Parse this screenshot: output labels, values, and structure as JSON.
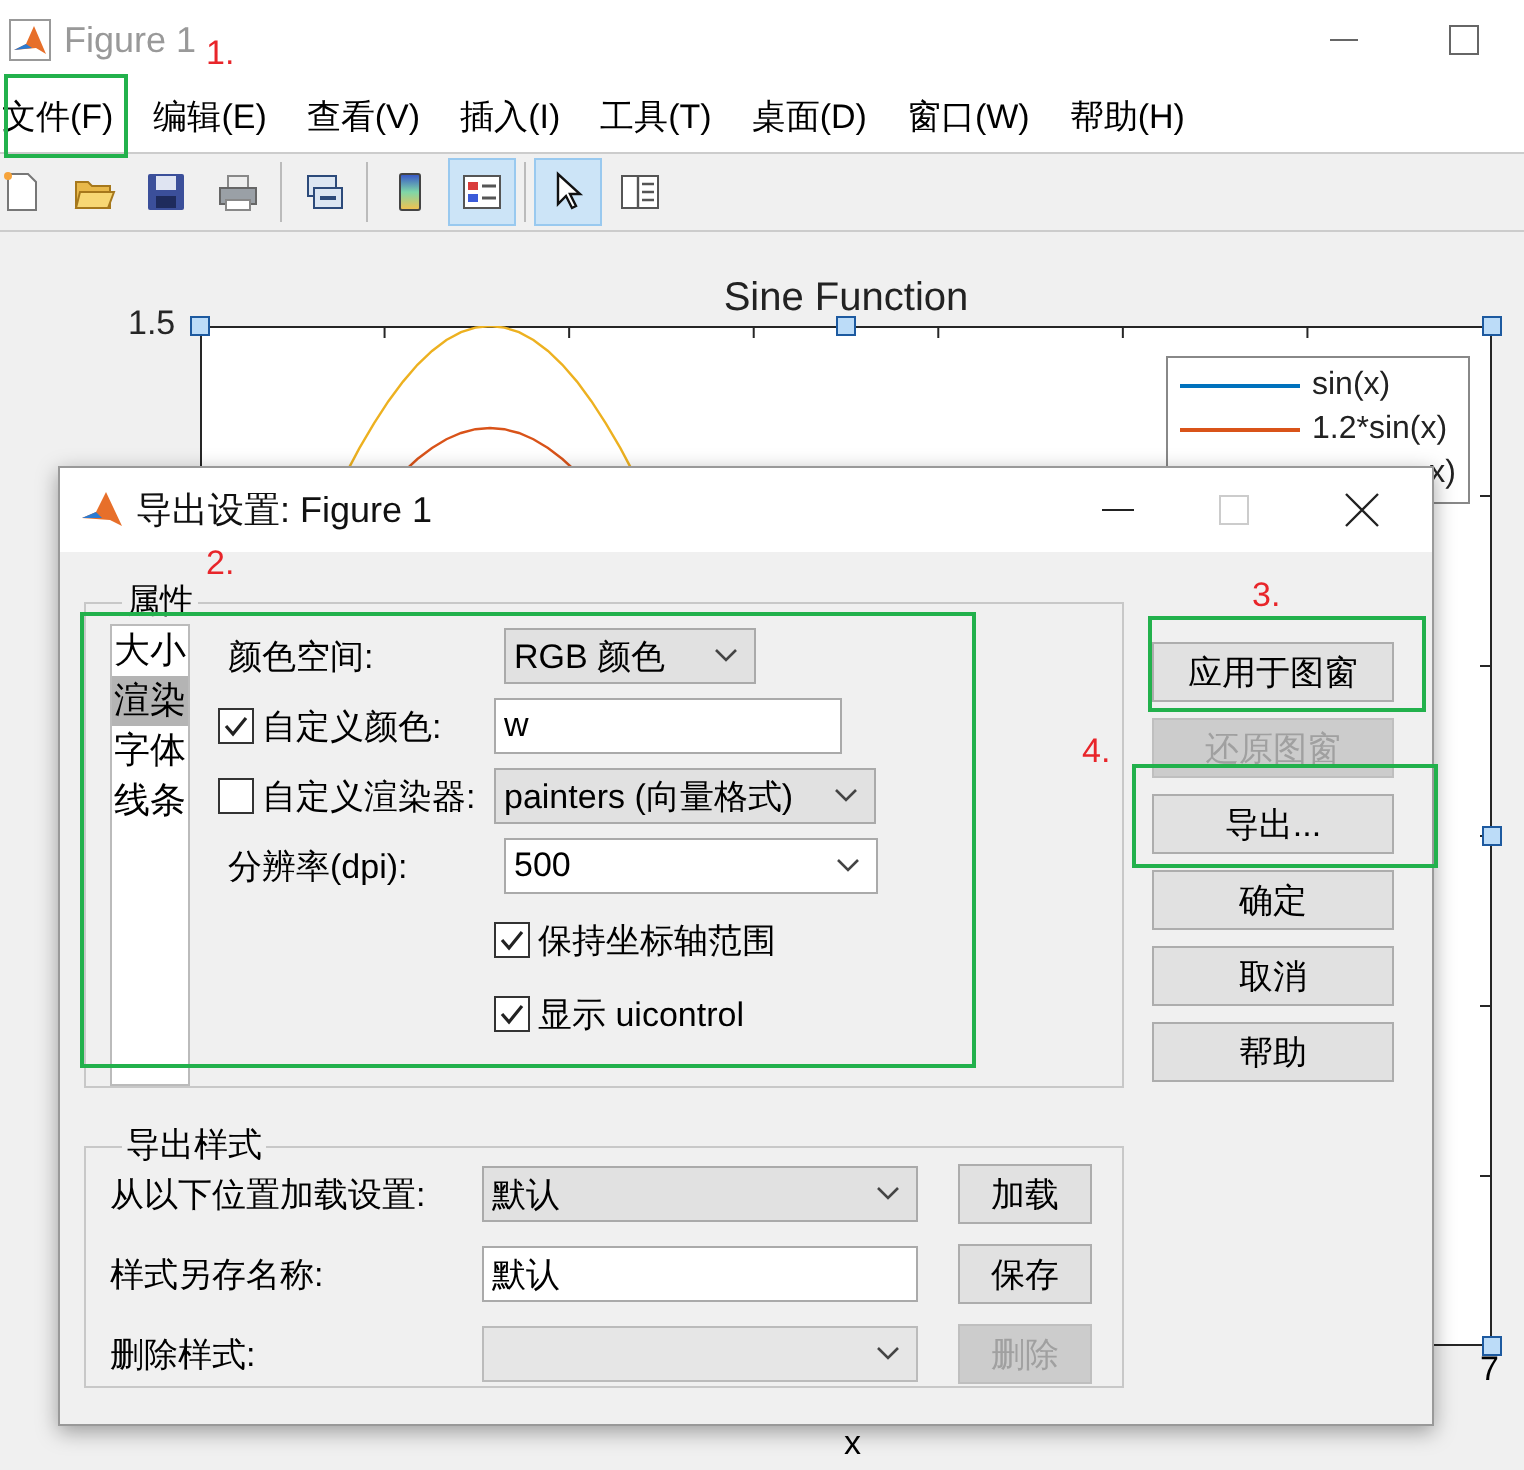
{
  "window": {
    "title": "Figure 1"
  },
  "menu": [
    {
      "label": "文件(F)"
    },
    {
      "label": "编辑(E)"
    },
    {
      "label": "查看(V)"
    },
    {
      "label": "插入(I)"
    },
    {
      "label": "工具(T)"
    },
    {
      "label": "桌面(D)"
    },
    {
      "label": "窗口(W)"
    },
    {
      "label": "帮助(H)"
    }
  ],
  "toolbar": [
    {
      "kind": "new",
      "selected": false
    },
    {
      "kind": "open",
      "selected": false
    },
    {
      "kind": "save",
      "selected": false
    },
    {
      "kind": "print",
      "selected": false
    },
    {
      "kind": "sep"
    },
    {
      "kind": "link",
      "selected": false
    },
    {
      "kind": "sep"
    },
    {
      "kind": "colorbar",
      "selected": false
    },
    {
      "kind": "legend",
      "selected": true
    },
    {
      "kind": "sep"
    },
    {
      "kind": "pointer",
      "selected": true
    },
    {
      "kind": "panel",
      "selected": false
    }
  ],
  "plot": {
    "title": "Sine Function",
    "ytick": "1.5",
    "xtick": "7",
    "xlabel": "x",
    "legend": [
      {
        "label": "sin(x)",
        "color": "#0072bd"
      },
      {
        "label": "1.2*sin(x)",
        "color": "#d95319"
      },
      {
        "label": "x)"
      }
    ]
  },
  "dialog": {
    "title": "导出设置: Figure 1",
    "properties": {
      "legend": "属性",
      "categories": [
        {
          "label": "大小",
          "selected": false
        },
        {
          "label": "渲染",
          "selected": true
        },
        {
          "label": "字体",
          "selected": false
        },
        {
          "label": "线条",
          "selected": false
        }
      ],
      "fields": [
        {
          "kind": "dropdown",
          "label": "颜色空间:",
          "value": "RGB 颜色"
        },
        {
          "kind": "text",
          "label": "自定义颜色:",
          "checked": true,
          "value": "w"
        },
        {
          "kind": "dropdown",
          "label": "自定义渲染器:",
          "checked": false,
          "value": "painters (向量格式)"
        },
        {
          "kind": "combo",
          "label": "分辨率(dpi):",
          "value": "500"
        }
      ],
      "options": [
        {
          "label": "保持坐标轴范围",
          "checked": true
        },
        {
          "label": "显示 uicontrol",
          "checked": true
        }
      ]
    },
    "buttons": [
      {
        "label": "应用于图窗",
        "disabled": false
      },
      {
        "label": "还原图窗",
        "disabled": true
      },
      {
        "label": "导出...",
        "disabled": false
      },
      {
        "label": "确定",
        "disabled": false
      },
      {
        "label": "取消",
        "disabled": false
      },
      {
        "label": "帮助",
        "disabled": false
      }
    ],
    "style": {
      "legend": "导出样式",
      "rows": [
        {
          "label": "从以下位置加载设置:",
          "kind": "dropdown",
          "value": "默认",
          "disabled": false,
          "button": "加载",
          "button_disabled": false
        },
        {
          "label": "样式另存名称:",
          "kind": "text",
          "value": "默认",
          "disabled": false,
          "button": "保存",
          "button_disabled": false
        },
        {
          "label": "删除样式:",
          "kind": "dropdown",
          "disabled": true,
          "button": "删除",
          "button_disabled": true
        }
      ]
    }
  },
  "annotations": [
    {
      "label": "1."
    },
    {
      "label": "2."
    },
    {
      "label": "3."
    },
    {
      "label": "4."
    }
  ]
}
